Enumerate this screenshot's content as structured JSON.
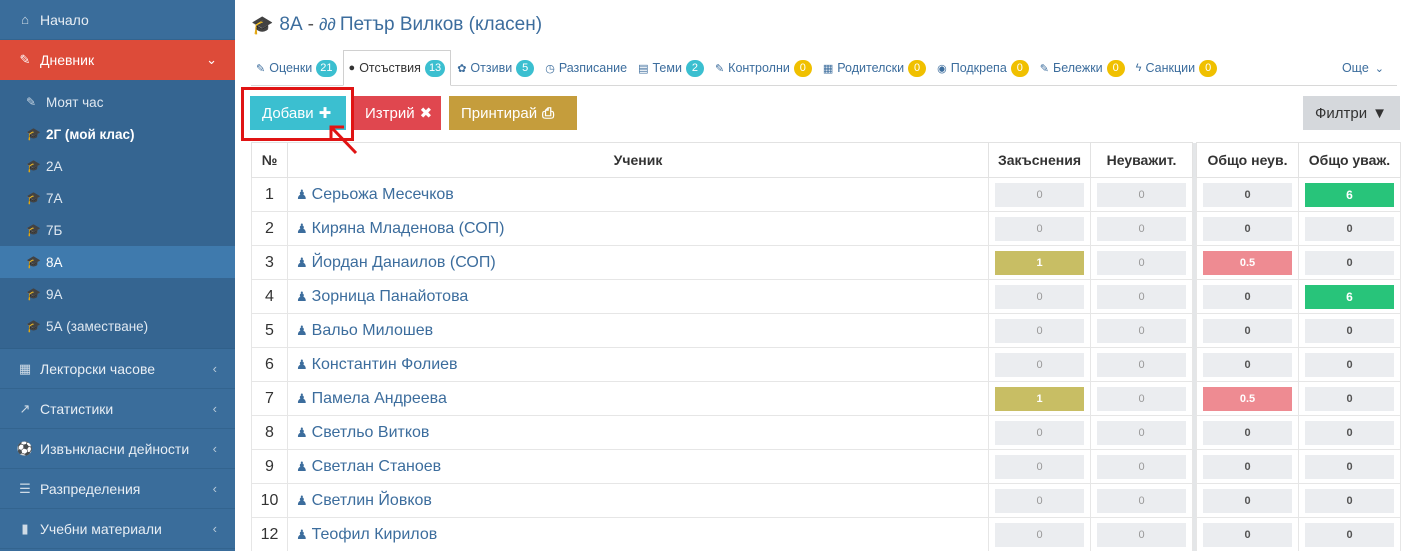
{
  "sidebar": {
    "home": "Начало",
    "diary": "Дневник",
    "sub": [
      "Моят час",
      "2Г (мой клас)",
      "2А",
      "7А",
      "7Б",
      "8А",
      "9А",
      "5А (заместване)"
    ],
    "lectures": "Лекторски часове",
    "stats": "Статистики",
    "extracurricular": "Извънкласни дейности",
    "distributions": "Разпределения",
    "materials": "Учебни материали"
  },
  "header": {
    "class_name": "8А",
    "separator": "-",
    "teacher": "Петър Вилков (класен)"
  },
  "tabs": [
    {
      "label": "Оценки",
      "badge": "21"
    },
    {
      "label": "Отсъствия",
      "badge": "13"
    },
    {
      "label": "Отзиви",
      "badge": "5"
    },
    {
      "label": "Разписание",
      "badge": ""
    },
    {
      "label": "Теми",
      "badge": "2"
    },
    {
      "label": "Контролни",
      "badge": "0"
    },
    {
      "label": "Родителски",
      "badge": "0"
    },
    {
      "label": "Подкрепа",
      "badge": "0"
    },
    {
      "label": "Бележки",
      "badge": "0"
    },
    {
      "label": "Санкции",
      "badge": "0"
    },
    {
      "label": "Още",
      "badge": ""
    }
  ],
  "toolbar": {
    "add": "Добави",
    "delete": "Изтрий",
    "print": "Принтирай",
    "filters": "Филтри"
  },
  "table": {
    "headers": [
      "№",
      "Ученик",
      "Закъснения",
      "Неуважит.",
      "Общо неув.",
      "Общо уваж."
    ],
    "rows": [
      {
        "no": "1",
        "name": "Серьожа Месечков",
        "late": "0",
        "unexc": "0",
        "total_unexc": "0",
        "total_exc": "6"
      },
      {
        "no": "2",
        "name": "Киряна Младенова (СОП)",
        "late": "0",
        "unexc": "0",
        "total_unexc": "0",
        "total_exc": "0"
      },
      {
        "no": "3",
        "name": "Йордан Данаилов (СОП)",
        "late": "1",
        "unexc": "0",
        "total_unexc": "0.5",
        "total_exc": "0"
      },
      {
        "no": "4",
        "name": "Зорница Панайотова",
        "late": "0",
        "unexc": "0",
        "total_unexc": "0",
        "total_exc": "6"
      },
      {
        "no": "5",
        "name": "Вальо Милошев",
        "late": "0",
        "unexc": "0",
        "total_unexc": "0",
        "total_exc": "0"
      },
      {
        "no": "6",
        "name": "Константин Фолиев",
        "late": "0",
        "unexc": "0",
        "total_unexc": "0",
        "total_exc": "0"
      },
      {
        "no": "7",
        "name": "Памела Андреева",
        "late": "1",
        "unexc": "0",
        "total_unexc": "0.5",
        "total_exc": "0"
      },
      {
        "no": "8",
        "name": "Светльо Витков",
        "late": "0",
        "unexc": "0",
        "total_unexc": "0",
        "total_exc": "0"
      },
      {
        "no": "9",
        "name": "Светлан Станоев",
        "late": "0",
        "unexc": "0",
        "total_unexc": "0",
        "total_exc": "0"
      },
      {
        "no": "10",
        "name": "Светлин Йовков",
        "late": "0",
        "unexc": "0",
        "total_unexc": "0",
        "total_exc": "0"
      },
      {
        "no": "12",
        "name": "Теофил Кирилов",
        "late": "0",
        "unexc": "0",
        "total_unexc": "0",
        "total_exc": "0"
      }
    ]
  },
  "colors": {
    "sidebar": "#3a6d9b",
    "active_menu": "#dd4b39",
    "add": "#3bbfd0",
    "delete": "#e0474f",
    "print": "#c59d3c",
    "late_highlight": "#c8be64",
    "unexcused_highlight": "#ee8b92",
    "excused_highlight": "#28c47a"
  },
  "icons": {
    "home": "home-icon",
    "diary": "edit-icon",
    "class": "graduation-cap-icon",
    "student": "student-icon"
  }
}
